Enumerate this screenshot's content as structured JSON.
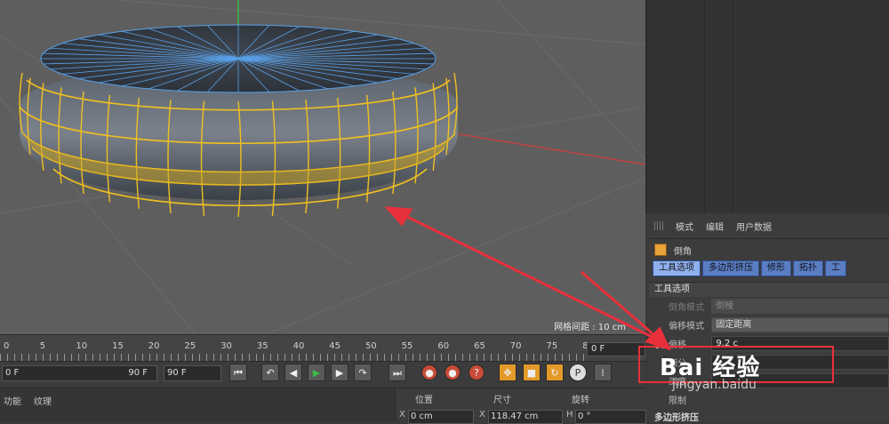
{
  "viewport": {
    "grid_spacing_label": "网格间距 : 10 cm"
  },
  "attributes_panel": {
    "menu": [
      "模式",
      "编辑",
      "用户数据"
    ],
    "object_name": "倒角",
    "tabs": [
      "工具选项",
      "多边形挤压",
      "修形",
      "拓扑",
      "工"
    ],
    "section_title": "工具选项",
    "rows": [
      {
        "label": "倒角模式",
        "value": "倒棱",
        "disabled": true
      },
      {
        "label": "偏移模式",
        "value": "固定距离",
        "disabled": false
      },
      {
        "label": "偏移",
        "value": "9.2 c",
        "disabled": false
      },
      {
        "label": "细分",
        "value": "",
        "disabled": false
      },
      {
        "label": "深度",
        "value": "",
        "disabled": false
      },
      {
        "label": "限制",
        "value": "",
        "disabled": false
      }
    ],
    "footer_section": "多边形挤压"
  },
  "timeline": {
    "ticks": [
      "0",
      "5",
      "10",
      "15",
      "20",
      "25",
      "30",
      "35",
      "40",
      "45",
      "50",
      "55",
      "60",
      "65",
      "70",
      "75",
      "80",
      "85",
      "90"
    ],
    "current_frame": "0 F"
  },
  "transport": {
    "start_frame": "0 F",
    "end_frame": "90 F",
    "max_frame": "90 F",
    "button_icons": [
      "goto-start-icon",
      "prev-key-icon",
      "prev-frame-icon",
      "play-icon",
      "next-frame-icon",
      "next-key-icon",
      "goto-end-icon",
      "record-icon",
      "autokey-icon",
      "help-key-icon",
      "move-icon",
      "scale-icon",
      "rotate-icon",
      "param-icon",
      "grid-dots-icon"
    ]
  },
  "bottom_menu": [
    "功能",
    "纹理"
  ],
  "coordinates": {
    "headers": [
      "位置",
      "尺寸",
      "旋转"
    ],
    "axes": [
      "X",
      "X",
      "H"
    ],
    "values": [
      "0 cm",
      "118.47 cm",
      "0 °"
    ]
  },
  "watermark": {
    "logo_text": "Bai 经验",
    "sub_text": "jingyan.baidu"
  },
  "colors": {
    "selection": "#f0c020",
    "mesh_edge": "#5aa0e8",
    "viewport_bg": "#5e5e5e",
    "annotation": "#e8303a"
  }
}
